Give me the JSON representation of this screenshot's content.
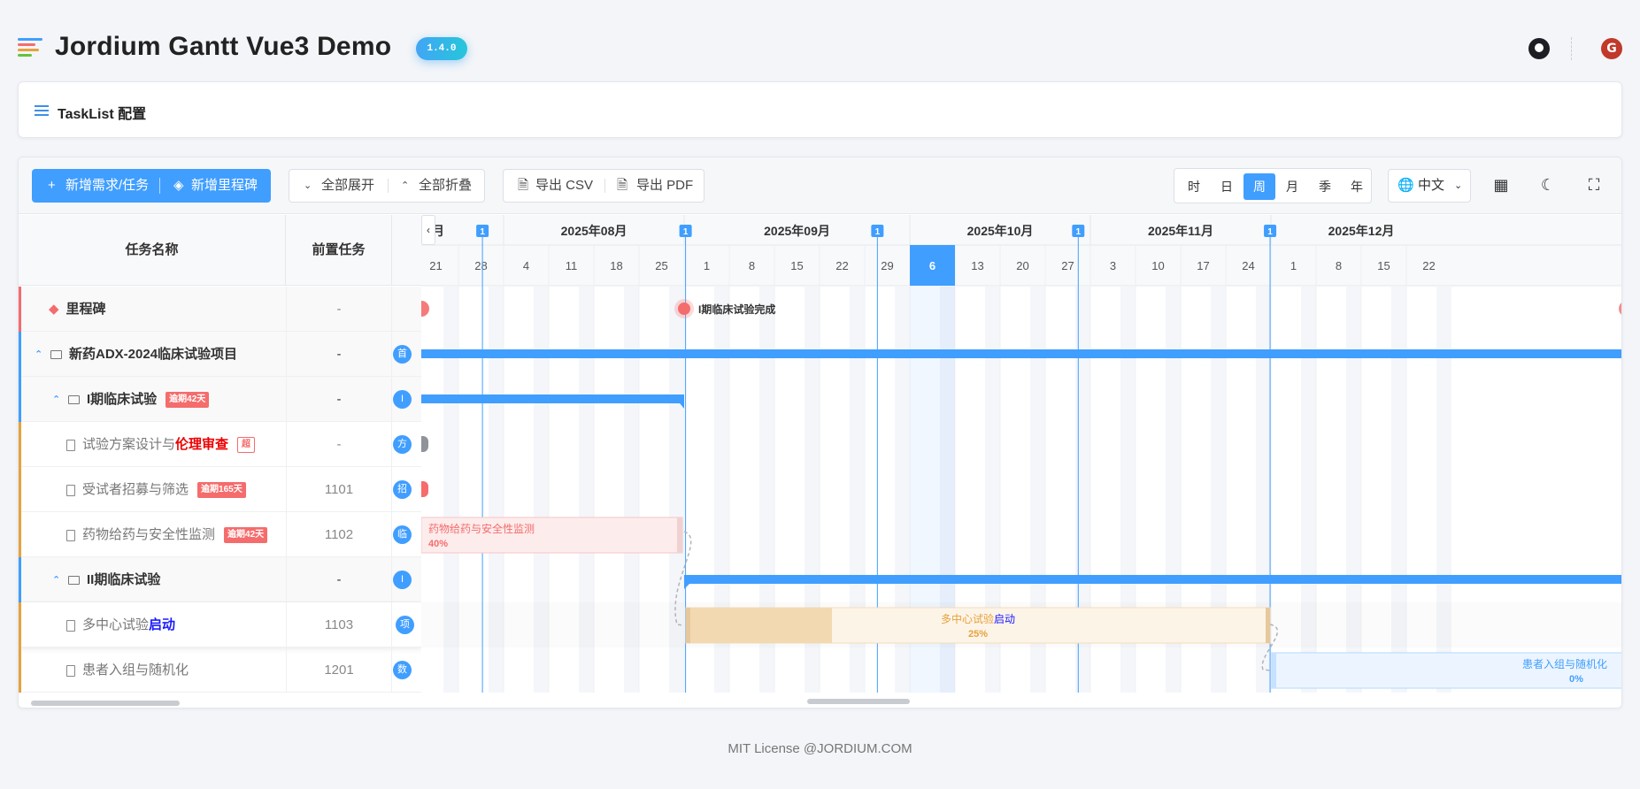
{
  "header": {
    "title": "Jordium Gantt Vue3 Demo",
    "version": "1.4.0",
    "icons": {
      "logo": "gantt-logo-icon",
      "github": "github-icon",
      "brand": "g-brand-icon"
    },
    "brand_letter": "G"
  },
  "config_panel": {
    "title": "TaskList 配置"
  },
  "toolbar": {
    "add_task": "新增需求/任务",
    "add_milestone": "新增里程碑",
    "expand_all": "全部展开",
    "collapse_all": "全部折叠",
    "export_csv": "导出 CSV",
    "export_pdf": "导出 PDF",
    "views": [
      "时",
      "日",
      "周",
      "月",
      "季",
      "年"
    ],
    "active_view": "周",
    "language": "中文"
  },
  "task_list": {
    "headers": {
      "name": "任务名称",
      "predecessor": "前置任务"
    },
    "rows": [
      {
        "name": "里程碑",
        "predecessor": "-",
        "avatar": "",
        "tag": "",
        "kind": "milestone",
        "color": "#f56c6c"
      },
      {
        "name": "新药ADX-2024临床试验项目",
        "predecessor": "-",
        "avatar": "首",
        "tag": "",
        "kind": "project",
        "color": "#409eff"
      },
      {
        "name": "I期临床试验",
        "predecessor": "-",
        "avatar": "I",
        "tag": "逾期42天",
        "kind": "group",
        "color": "#409eff"
      },
      {
        "name_prefix": "试验方案设计与",
        "name_emph": "伦理审查",
        "predecessor": "-",
        "avatar": "方",
        "tag": "超",
        "kind": "task",
        "color": "#e6a23c"
      },
      {
        "name": "受试者招募与筛选",
        "predecessor": "1101",
        "avatar": "招",
        "tag": "逾期165天",
        "kind": "task",
        "color": "#e6a23c"
      },
      {
        "name": "药物给药与安全性监测",
        "predecessor": "1102",
        "avatar": "临",
        "tag": "逾期42天",
        "kind": "task",
        "color": "#e6a23c"
      },
      {
        "name": "II期临床试验",
        "predecessor": "-",
        "avatar": "I",
        "tag": "",
        "kind": "group",
        "color": "#409eff"
      },
      {
        "name_prefix": "多中心试验",
        "name_emph": "启动",
        "predecessor": "1103",
        "avatar": "项",
        "tag": "",
        "kind": "task",
        "color": "#e6a23c"
      },
      {
        "name": "患者入组与随机化",
        "predecessor": "1201",
        "avatar": "数",
        "tag": "",
        "kind": "task",
        "color": "#e6a23c"
      }
    ]
  },
  "timeline": {
    "months": [
      "月",
      "2025年08月",
      "2025年09月",
      "2025年10月",
      "2025年11月",
      "2025年12月"
    ],
    "weeks": [
      "21",
      "28",
      "4",
      "11",
      "18",
      "25",
      "1",
      "8",
      "15",
      "22",
      "29",
      "6",
      "13",
      "20",
      "27",
      "3",
      "10",
      "17",
      "24",
      "1",
      "8",
      "15",
      "22"
    ],
    "today_week": "6",
    "marker_label": "1"
  },
  "chart_data": {
    "type": "gantt",
    "milestones": [
      {
        "name": "I期临床试验完成",
        "week": "2025-09-01"
      }
    ],
    "bars": [
      {
        "name": "新药ADX-2024临床试验项目",
        "row": 1,
        "progress": null
      },
      {
        "name": "I期临床试验",
        "row": 2,
        "progress": null
      },
      {
        "name": "药物给药与安全性监测",
        "row": 5,
        "progress": 0.4,
        "progress_label": "40%"
      },
      {
        "name": "II期临床试验",
        "row": 6,
        "progress": null
      },
      {
        "name_prefix": "多中心试验",
        "name_emph": "启动",
        "row": 7,
        "progress": 0.25,
        "progress_label": "25%"
      },
      {
        "name": "患者入组与随机化",
        "row": 8,
        "progress": 0.0,
        "progress_label": "0%"
      }
    ]
  },
  "colors": {
    "primary": "#409eff",
    "danger": "#f56c6c",
    "warning": "#e6a23c"
  },
  "footer": {
    "text": "MIT License @JORDIUM.COM"
  }
}
